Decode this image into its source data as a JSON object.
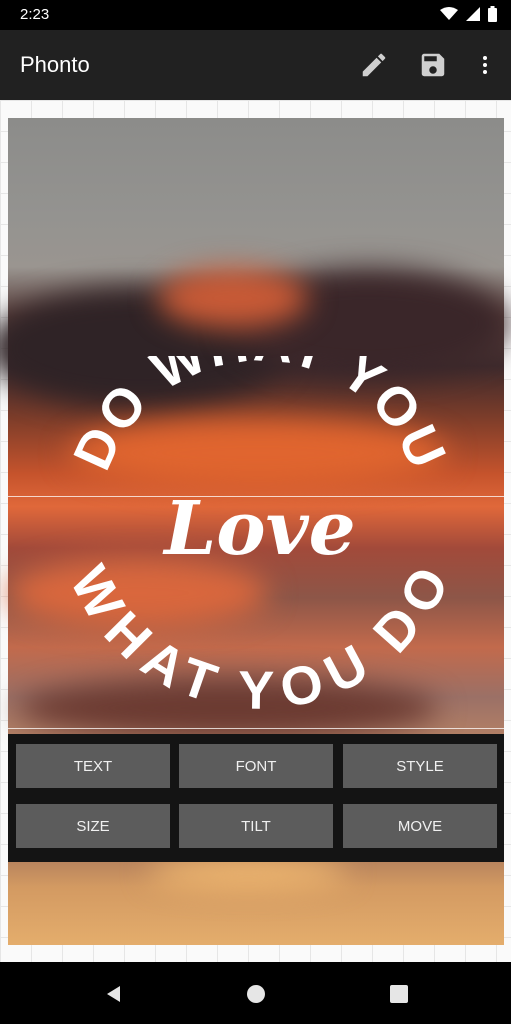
{
  "status_bar": {
    "time": "2:23"
  },
  "app_bar": {
    "title": "Phonto",
    "icons": [
      "pencil-icon",
      "save-icon",
      "more-vert-icon"
    ]
  },
  "image_text": {
    "top_arc": "DO WHAT YOU",
    "center": "Love",
    "bottom_arc": "WHAT YOU DO"
  },
  "panel": {
    "buttons": [
      "TEXT",
      "FONT",
      "STYLE",
      "SIZE",
      "TILT",
      "MOVE"
    ]
  },
  "nav": {
    "icons": [
      "back-icon",
      "home-icon",
      "recents-icon"
    ]
  },
  "colors": {
    "app_bar": "#212121",
    "button": "#5c5c5c",
    "panel": "#141414"
  }
}
